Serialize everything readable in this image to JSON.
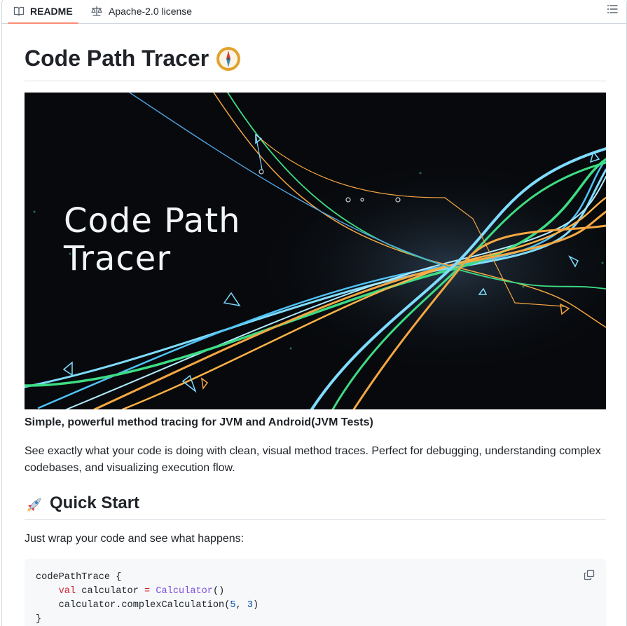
{
  "tabs": {
    "readme_label": "README",
    "license_label": "Apache-2.0 license"
  },
  "readme": {
    "title": "Code Path Tracer",
    "title_emoji": "compass-emoji",
    "hero": {
      "line1": "Code Path",
      "line2": "Tracer",
      "icon": "abstract-code-paths-image"
    },
    "tagline": "Simple, powerful method tracing for JVM and Android(JVM Tests)",
    "description": "See exactly what your code is doing with clean, visual method traces. Perfect for debugging, understanding complex codebases, and visualizing execution flow.",
    "quick_start": {
      "heading": "Quick Start",
      "heading_emoji": "rocket-emoji",
      "intro": "Just wrap your code and see what happens:",
      "code": {
        "line1_fn": "codePathTrace",
        "line1_brace": " {",
        "line2_indent": "    ",
        "line2_kw": "val",
        "line2_name": " calculator ",
        "line2_op": "=",
        "line2_space": " ",
        "line2_class": "Calculator",
        "line2_call": "()",
        "line3_indent": "    ",
        "line3_call": "calculator.complexCalculation(",
        "line3_arg1": "5",
        "line3_sep": ", ",
        "line3_arg2": "3",
        "line3_close": ")",
        "line4": "}"
      }
    }
  },
  "colors": {
    "tab_underline": "#fd8c73",
    "keyword": "#cf222e",
    "class": "#8250df",
    "number": "#0550ae",
    "code_bg": "#f6f8fa"
  }
}
